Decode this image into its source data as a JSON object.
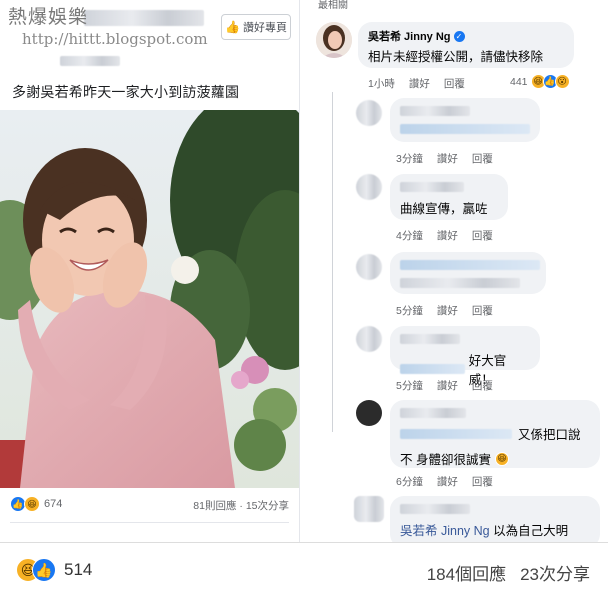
{
  "watermark": {
    "title": "熱爆娛樂",
    "url": "http://hittt.blogspot.com"
  },
  "post": {
    "like_page_label": "讚好專頁",
    "caption": "多謝吳若希昨天一家大小到訪菠蘿園",
    "reaction_count": "674",
    "comments_count": "81則回應",
    "shares_count": "15次分享"
  },
  "comments": {
    "sort_label": "最相關",
    "items": [
      {
        "name": "吳若希 Jinny Ng",
        "verified": true,
        "text": "相片未經授權公開，請儘快移除",
        "time": "1小時",
        "like": "讚好",
        "reply": "回覆",
        "reactions": "441"
      },
      {
        "time": "3分鐘",
        "like": "讚好",
        "reply": "回覆"
      },
      {
        "text": "曲線宣傳，贏咗",
        "time": "4分鐘",
        "like": "讚好",
        "reply": "回覆"
      },
      {
        "time": "5分鐘",
        "like": "讚好",
        "reply": "回覆"
      },
      {
        "text": "好大官威！",
        "time": "5分鐘",
        "like": "讚好",
        "reply": "回覆"
      },
      {
        "text_a": "又係把口說",
        "text_b": "不 身體卻很誠實",
        "time": "6分鐘",
        "like": "讚好",
        "reply": "回覆"
      },
      {
        "tag": "吳若希 Jinny Ng",
        "text": "以為自己大明"
      }
    ]
  },
  "bottom": {
    "reaction_count": "514",
    "comments": "184個回應",
    "shares": "23次分享"
  },
  "colors": {
    "facebook_blue": "#1877f2",
    "bubble_bg": "#f0f2f5",
    "meta_text": "#65676b"
  },
  "icons": [
    "like-icon",
    "haha-icon",
    "wow-icon",
    "verified-icon",
    "thumb-icon"
  ]
}
